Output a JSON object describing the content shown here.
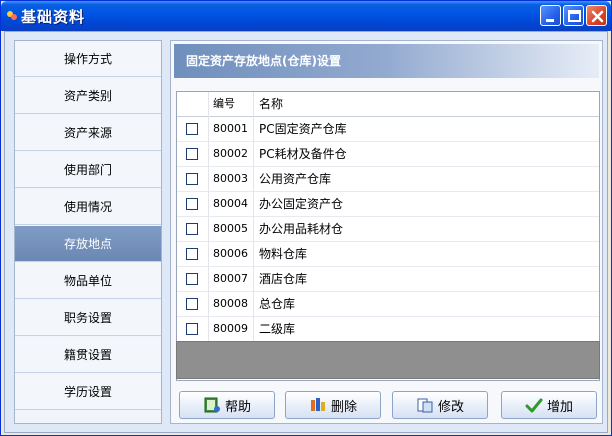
{
  "window": {
    "title": "基础资料"
  },
  "nav": {
    "items": [
      {
        "label": "操作方式",
        "active": false
      },
      {
        "label": "资产类别",
        "active": false
      },
      {
        "label": "资产来源",
        "active": false
      },
      {
        "label": "使用部门",
        "active": false
      },
      {
        "label": "使用情况",
        "active": false
      },
      {
        "label": "存放地点",
        "active": true
      },
      {
        "label": "物品单位",
        "active": false
      },
      {
        "label": "职务设置",
        "active": false
      },
      {
        "label": "籍贯设置",
        "active": false
      },
      {
        "label": "学历设置",
        "active": false
      }
    ]
  },
  "panel": {
    "title": "固定资产存放地点(仓库)设置"
  },
  "table": {
    "headers": {
      "code": "编号",
      "name": "名称"
    },
    "rows": [
      {
        "code": "80001",
        "name": "PC固定资产仓库",
        "checked": false
      },
      {
        "code": "80002",
        "name": "PC耗材及备件仓",
        "checked": false
      },
      {
        "code": "80003",
        "name": "公用资产仓库",
        "checked": false
      },
      {
        "code": "80004",
        "name": "办公固定资产仓",
        "checked": false
      },
      {
        "code": "80005",
        "name": "办公用品耗材仓",
        "checked": false
      },
      {
        "code": "80006",
        "name": "物料仓库",
        "checked": false
      },
      {
        "code": "80007",
        "name": "酒店仓库",
        "checked": false
      },
      {
        "code": "80008",
        "name": "总仓库",
        "checked": false
      },
      {
        "code": "80009",
        "name": "二级库",
        "checked": false
      }
    ]
  },
  "buttons": {
    "help": "帮助",
    "delete": "删除",
    "edit": "修改",
    "add": "增加"
  },
  "colors": {
    "titlebar": "#0055e5",
    "nav_active": "#6b88b3",
    "panel_header": "#6f8fbc"
  }
}
